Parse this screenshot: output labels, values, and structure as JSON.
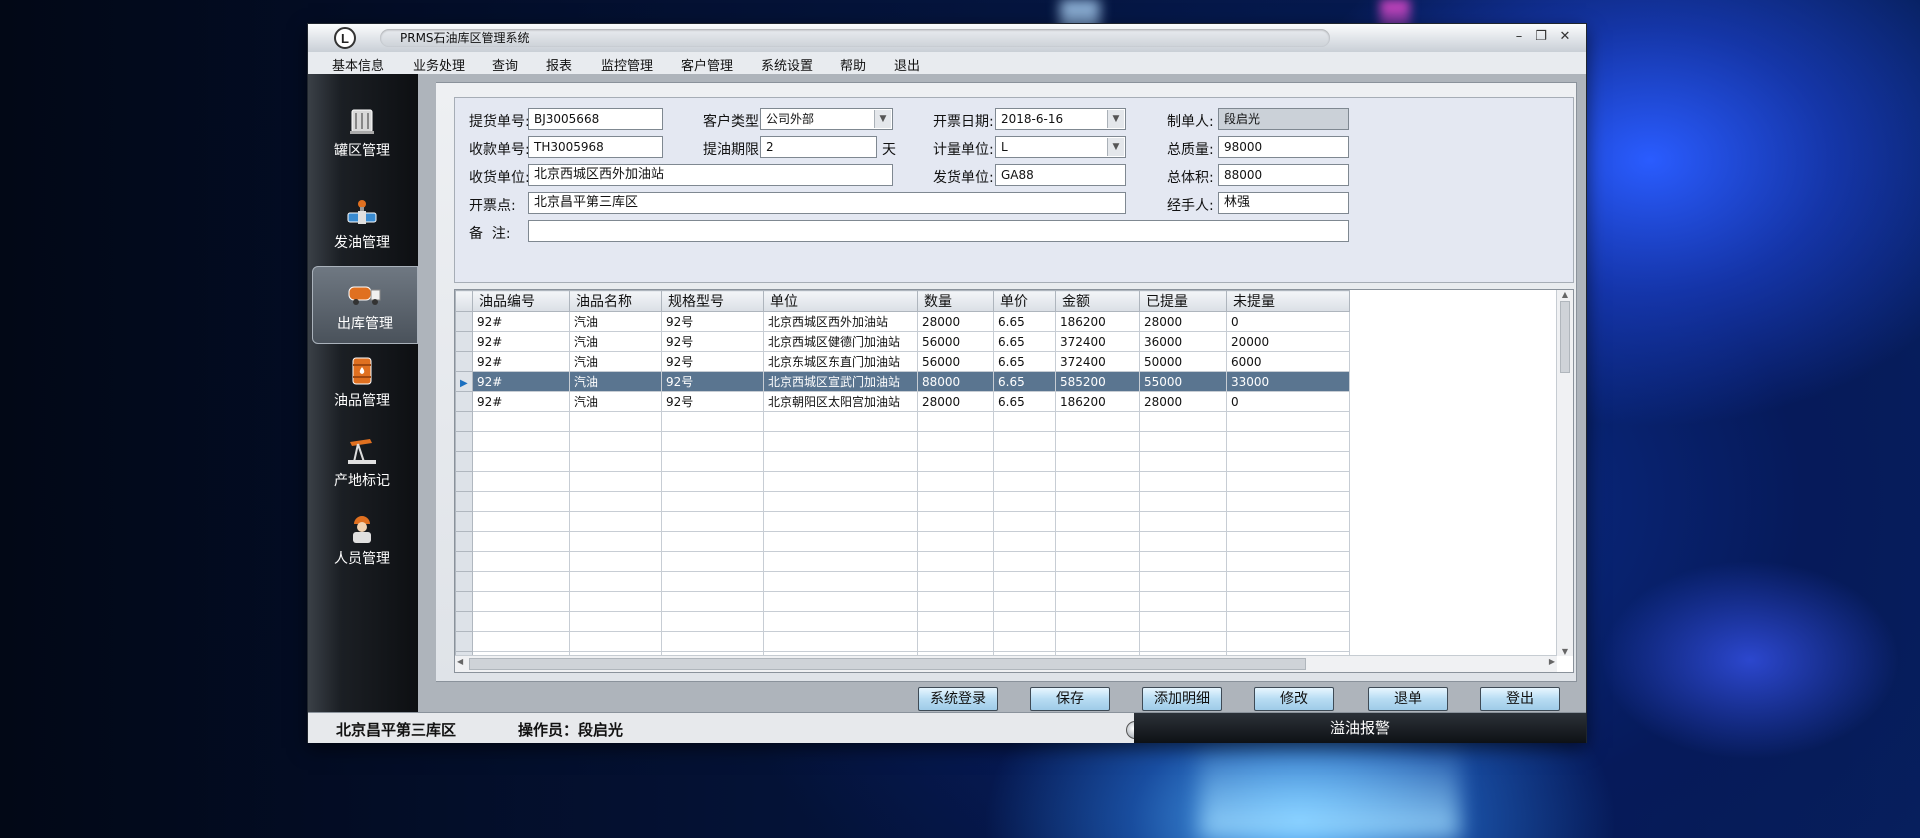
{
  "window": {
    "title": "PRMS石油库区管理系统",
    "minimize": "–",
    "restore": "❐",
    "close": "✕",
    "logo": "L"
  },
  "menu": [
    "基本信息",
    "业务处理",
    "查询",
    "报表",
    "监控管理",
    "客户管理",
    "系统设置",
    "帮助",
    "退出"
  ],
  "sidebar": {
    "items": [
      {
        "label": "罐区管理",
        "icon": "tank-icon"
      },
      {
        "label": "发油管理",
        "icon": "valve-icon"
      },
      {
        "label": "出库管理",
        "icon": "truck-icon",
        "active": true
      },
      {
        "label": "油品管理",
        "icon": "oil-barrel-icon"
      },
      {
        "label": "产地标记",
        "icon": "pumpjack-icon"
      },
      {
        "label": "人员管理",
        "icon": "worker-icon"
      }
    ]
  },
  "form": {
    "pickup_no_label": "提货单号:",
    "pickup_no": "BJ3005668",
    "customer_type_label": "客户类型:",
    "customer_type": "公司外部",
    "invoice_date_label": "开票日期:",
    "invoice_date": "2018-6-16",
    "maker_label": "制单人:",
    "maker": "段启光",
    "receipt_no_label": "收款单号:",
    "receipt_no": "TH3005968",
    "pickup_period_label": "提油期限:",
    "pickup_period": "2",
    "pickup_period_unit": "天",
    "measure_unit_label": "计量单位:",
    "measure_unit": "L",
    "total_mass_label": "总质量:",
    "total_mass": "98000",
    "receiver_label": "收货单位:",
    "receiver": "北京西城区西外加油站",
    "shipper_label": "发货单位:",
    "shipper": "GA88",
    "total_volume_label": "总体积:",
    "total_volume": "88000",
    "invoice_point_label": "开票点:",
    "invoice_point": "北京昌平第三库区",
    "handler_label": "经手人:",
    "handler": "林强",
    "remark_label": "备  注:",
    "remark": ""
  },
  "grid": {
    "columns": [
      "油品编号",
      "油品名称",
      "规格型号",
      "单位",
      "数量",
      "单价",
      "金额",
      "已提量",
      "未提量"
    ],
    "rows": [
      [
        "92#",
        "汽油",
        "92号",
        "北京西城区西外加油站",
        "28000",
        "6.65",
        "186200",
        "28000",
        "0"
      ],
      [
        "92#",
        "汽油",
        "92号",
        "北京西城区健德门加油站",
        "56000",
        "6.65",
        "372400",
        "36000",
        "20000"
      ],
      [
        "92#",
        "汽油",
        "92号",
        "北京东城区东直门加油站",
        "56000",
        "6.65",
        "372400",
        "50000",
        "6000"
      ],
      [
        "92#",
        "汽油",
        "92号",
        "北京西城区宣武门加油站",
        "88000",
        "6.65",
        "585200",
        "55000",
        "33000"
      ],
      [
        "92#",
        "汽油",
        "92号",
        "北京朝阳区太阳宫加油站",
        "28000",
        "6.65",
        "186200",
        "28000",
        "0"
      ]
    ],
    "selected_row": 3
  },
  "buttons": [
    "系统登录",
    "保存",
    "添加明细",
    "修改",
    "退单",
    "登出"
  ],
  "status": {
    "location": "北京昌平第三库区",
    "operator": "操作员：段启光",
    "alarm": "溢油报警"
  }
}
